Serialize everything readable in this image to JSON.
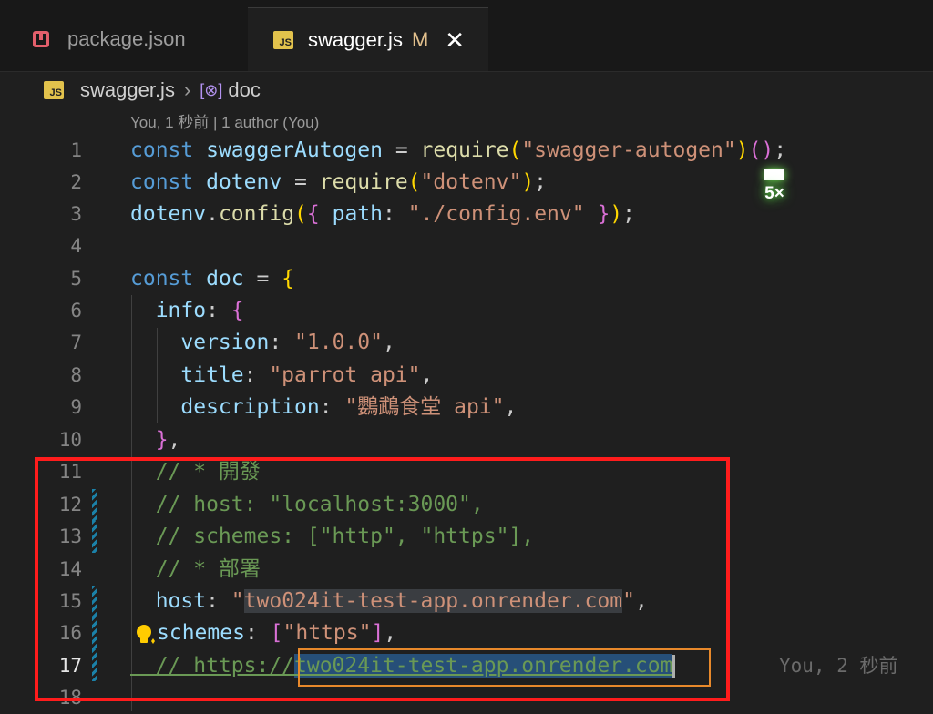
{
  "tabs": [
    {
      "label": "package.json",
      "icon": "package-json-icon",
      "active": false
    },
    {
      "label": "swagger.js",
      "icon": "js-file-icon",
      "active": true,
      "modified_marker": "M",
      "close_glyph": "✕"
    }
  ],
  "breadcrumb": {
    "file": "swagger.js",
    "separator": "›",
    "symbol_glyph": "[⊗]",
    "symbol": "doc"
  },
  "blame_header": "You, 1 秒前 | 1 author (You)",
  "inline_blame": "You, 2 秒前",
  "overlay": {
    "count": "5×"
  },
  "lines": [
    {
      "n": "1"
    },
    {
      "n": "2"
    },
    {
      "n": "3"
    },
    {
      "n": "4"
    },
    {
      "n": "5"
    },
    {
      "n": "6"
    },
    {
      "n": "7"
    },
    {
      "n": "8"
    },
    {
      "n": "9"
    },
    {
      "n": "10"
    },
    {
      "n": "11"
    },
    {
      "n": "12"
    },
    {
      "n": "13"
    },
    {
      "n": "14"
    },
    {
      "n": "15"
    },
    {
      "n": "16"
    },
    {
      "n": "17"
    },
    {
      "n": "18"
    }
  ],
  "code": {
    "l1": {
      "kw": "const",
      "name": " swaggerAutogen",
      "eq": " = ",
      "fn": "require",
      "open": "(",
      "str": "\"swagger-autogen\"",
      "close": ")",
      "call": "()",
      "semi": ";"
    },
    "l2": {
      "kw": "const",
      "name": " dotenv",
      "eq": " = ",
      "fn": "require",
      "open": "(",
      "str": "\"dotenv\"",
      "close": ")",
      "semi": ";"
    },
    "l3": {
      "obj": "dotenv",
      "dot": ".",
      "fn": "config",
      "open": "(",
      "brace_open": "{",
      "key": " path",
      "colon": ": ",
      "str": "\"./config.env\"",
      "brace_close": " }",
      "close": ")",
      "semi": ";"
    },
    "l5": {
      "kw": "const",
      "name": " doc",
      "eq": " = ",
      "brace": "{"
    },
    "l6": {
      "key": "  info",
      "colon": ": ",
      "brace": "{"
    },
    "l7": {
      "key": "    version",
      "colon": ": ",
      "str": "\"1.0.0\"",
      "comma": ","
    },
    "l8": {
      "key": "    title",
      "colon": ": ",
      "str": "\"parrot api\"",
      "comma": ","
    },
    "l9": {
      "key": "    description",
      "colon": ": ",
      "str": "\"鸚鵡食堂 api\"",
      "comma": ","
    },
    "l10": {
      "brace": "  }",
      "comma": ","
    },
    "l11": {
      "comment": "  // * 開發"
    },
    "l12": {
      "comment": "  // host: \"localhost:3000\","
    },
    "l13": {
      "comment": "  // schemes: [\"http\", \"https\"],"
    },
    "l14": {
      "comment": "  // * 部署"
    },
    "l15": {
      "key": "  host",
      "colon": ": ",
      "q": "\"",
      "str": "two024it-test-app.onrender.com",
      "q2": "\"",
      "comma": ","
    },
    "l16": {
      "key": "schemes",
      "colon": ": ",
      "open": "[",
      "str": "\"https\"",
      "close": "]",
      "comma": ","
    },
    "l17": {
      "comment": "  // https://",
      "selected": "two024it-test-app.onrender.com"
    }
  }
}
